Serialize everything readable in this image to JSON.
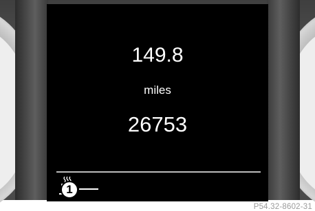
{
  "display": {
    "trip_value": "149.8",
    "unit": "miles",
    "odometer": "26753"
  },
  "indicator": {
    "icon": "coffee-cup-icon",
    "callout_number": "1"
  },
  "caption": "P54.32-8602-31"
}
